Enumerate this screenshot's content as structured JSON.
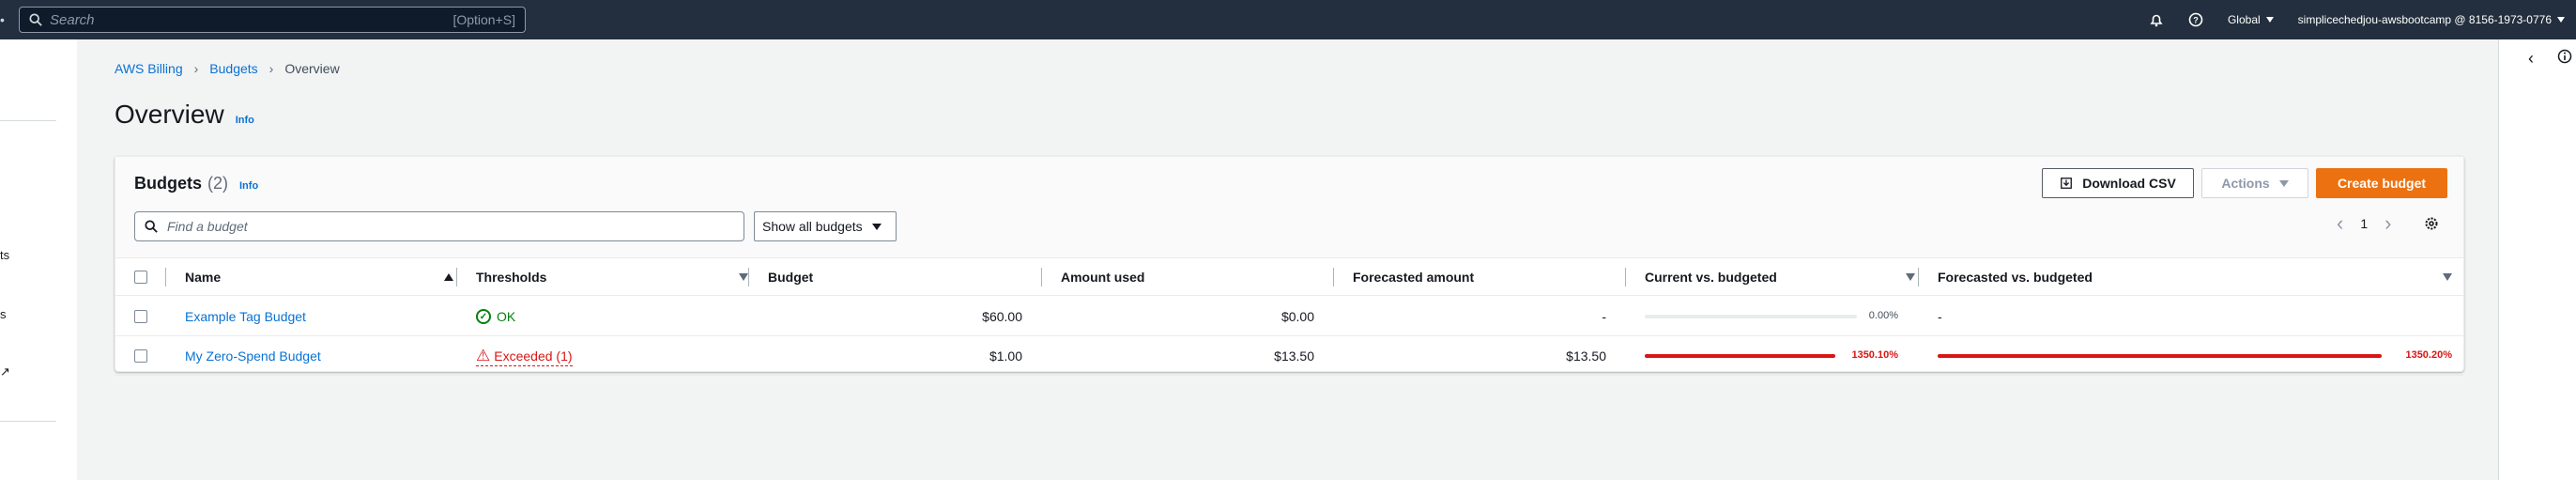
{
  "topbar": {
    "search_placeholder": "Search",
    "search_shortcut": "[Option+S]",
    "region": "Global",
    "account": "simplicechedjou-awsbootcamp @ 8156-1973-0776"
  },
  "sidebar": {
    "fragments": [
      "ts",
      "s",
      "↗"
    ]
  },
  "breadcrumb": {
    "items": [
      "AWS Billing",
      "Budgets",
      "Overview"
    ]
  },
  "page": {
    "title": "Overview",
    "info": "Info"
  },
  "budgets": {
    "title": "Budgets",
    "count": "(2)",
    "info": "Info",
    "download_label": "Download CSV",
    "actions_label": "Actions",
    "create_label": "Create budget",
    "search_placeholder": "Find a budget",
    "filter_value": "Show all budgets",
    "page_number": "1",
    "columns": [
      "Name",
      "Thresholds",
      "Budget",
      "Amount used",
      "Forecasted amount",
      "Current vs. budgeted",
      "Forecasted vs. budgeted"
    ],
    "rows": [
      {
        "name": "Example Tag Budget",
        "threshold": "OK",
        "budget": "$60.00",
        "amount_used": "$0.00",
        "forecasted": "-",
        "current_pct": "0.00%",
        "current_fraction": 0,
        "forecast_pct": "-"
      },
      {
        "name": "My Zero-Spend Budget",
        "threshold": "Exceeded (1)",
        "budget": "$1.00",
        "amount_used": "$13.50",
        "forecasted": "$13.50",
        "current_pct": "1350.10%",
        "current_fraction": 1,
        "forecast_pct": "1350.20%",
        "forecast_fraction": 1
      }
    ]
  },
  "colors": {
    "topbar": "#232f3e",
    "primary_button": "#ec7211",
    "link": "#0972d3",
    "ok": "#037f0c",
    "error": "#d91515"
  }
}
